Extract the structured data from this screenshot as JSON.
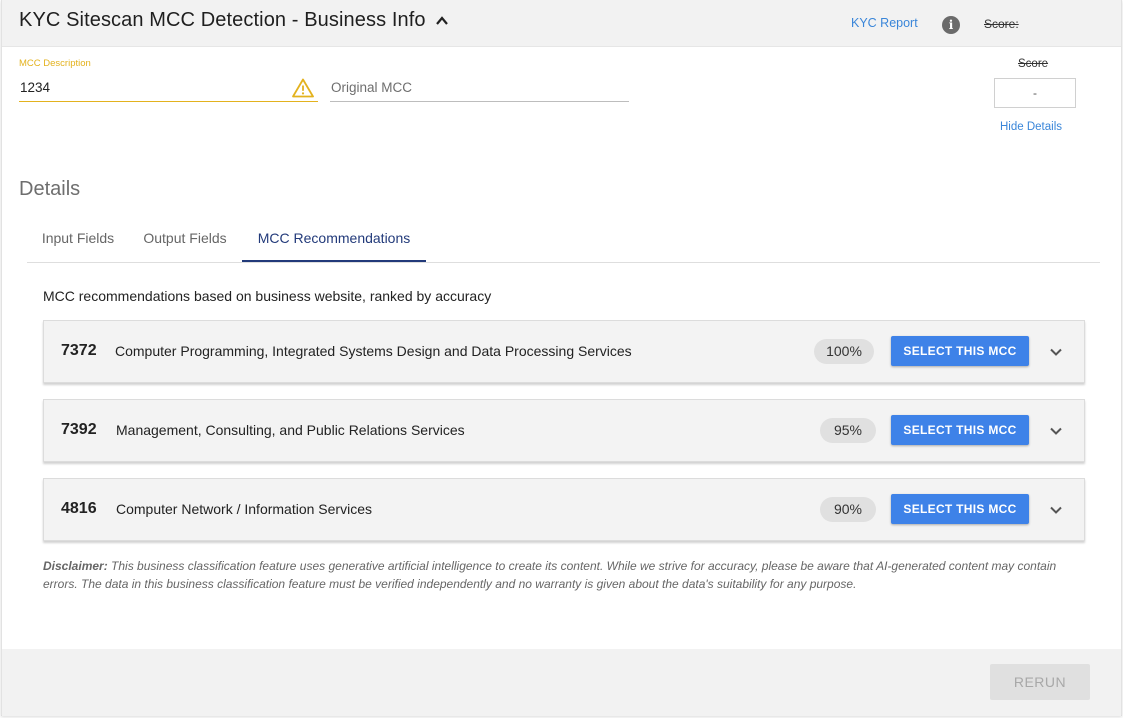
{
  "header": {
    "title": "KYC Sitescan MCC Detection - Business Info",
    "kyc_report": "KYC Report",
    "info_glyph": "i",
    "score_label": "Score:"
  },
  "form": {
    "mcc_description_label": "MCC Description",
    "mcc_description_value": "1234",
    "original_mcc_placeholder": "Original MCC"
  },
  "score": {
    "label": "Score",
    "value": "-",
    "hide_details": "Hide Details"
  },
  "details": {
    "title": "Details",
    "tabs": [
      {
        "label": "Input Fields",
        "active": false
      },
      {
        "label": "Output Fields",
        "active": false
      },
      {
        "label": "MCC Recommendations",
        "active": true
      }
    ]
  },
  "recommendations": {
    "intro": "MCC recommendations based on business website, ranked by accuracy",
    "select_label": "SELECT THIS MCC",
    "items": [
      {
        "code": "7372",
        "description": "Computer Programming, Integrated Systems Design and Data Processing Services",
        "accuracy": "100%"
      },
      {
        "code": "7392",
        "description": "Management, Consulting, and Public Relations Services",
        "accuracy": "95%"
      },
      {
        "code": "4816",
        "description": "Computer Network / Information Services",
        "accuracy": "90%"
      }
    ]
  },
  "disclaimer": {
    "label": "Disclaimer:",
    "text": " This business classification feature uses generative artificial intelligence to create its content. While we strive for accuracy, please be aware that AI-generated content may contain errors. The data in this business classification feature must be verified independently and no warranty is given about the data's suitability for any purpose."
  },
  "footer": {
    "rerun_label": "RERUN"
  },
  "colors": {
    "accent_blue": "#3e82e8",
    "link_blue": "#3a86d9",
    "warning_yellow": "#e3b21e",
    "active_tab": "#223a7a"
  },
  "icons": [
    "chevron-up-icon",
    "info-icon",
    "warning-icon",
    "chevron-down-icon"
  ]
}
